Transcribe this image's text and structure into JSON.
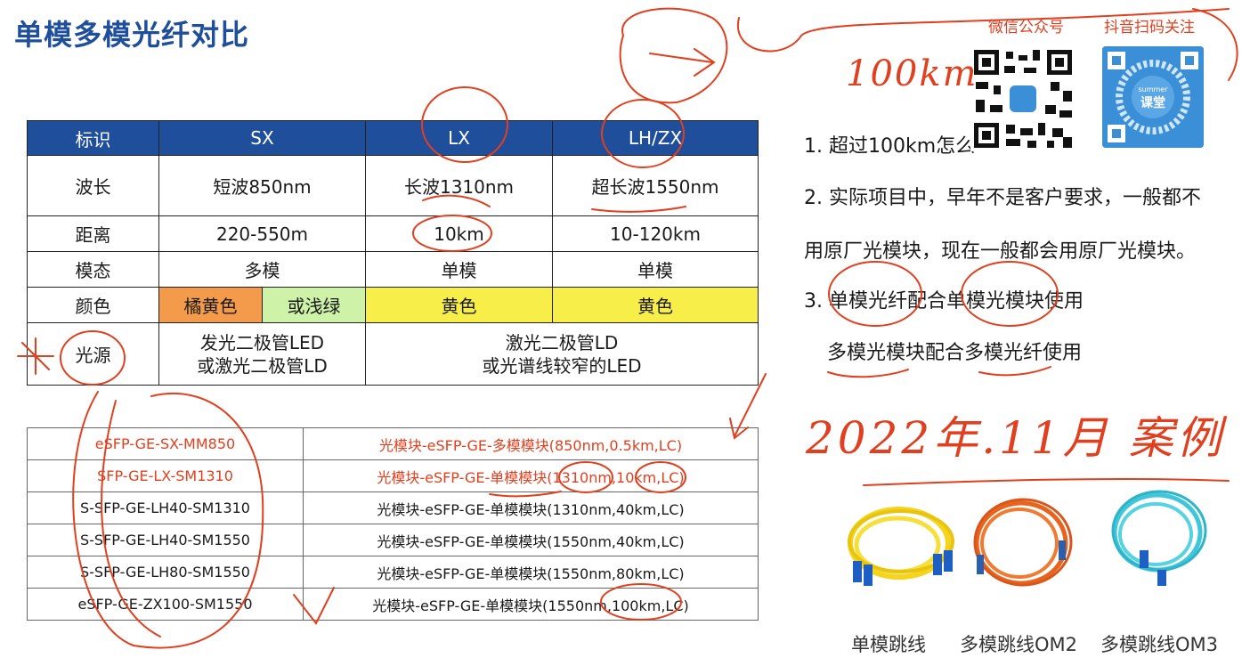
{
  "title": "单模多模光纤对比",
  "table1": {
    "headers": [
      "标识",
      "SX",
      "LX",
      "LH/ZX"
    ],
    "rows": {
      "wavelength": [
        "波长",
        "短波850nm",
        "长波1310nm",
        "超长波1550nm"
      ],
      "distance": [
        "距离",
        "220-550m",
        "10km",
        "10-120km"
      ],
      "mode": [
        "模态",
        "多模",
        "单模",
        "单模"
      ],
      "color": [
        "颜色",
        "橘黄色",
        "或浅绿",
        "黄色",
        "黄色"
      ],
      "source": [
        "光源",
        "发光二极管LED",
        "或激光二极管LD",
        "激光二极管LD",
        "或光谱线较窄的LED"
      ]
    }
  },
  "table2": [
    {
      "code": "eSFP-GE-SX-MM850",
      "desc": "光模块-eSFP-GE-多模模块(850nm,0.5km,LC)",
      "highlight": true
    },
    {
      "code": "SFP-GE-LX-SM1310",
      "desc": "光模块-eSFP-GE-单模模块(1310nm,10km,LC)",
      "highlight": true
    },
    {
      "code": "S-SFP-GE-LH40-SM1310",
      "desc": "光模块-eSFP-GE-单模模块(1310nm,40km,LC)",
      "highlight": false
    },
    {
      "code": "S-SFP-GE-LH40-SM1550",
      "desc": "光模块-eSFP-GE-单模模块(1550nm,40km,LC)",
      "highlight": false
    },
    {
      "code": "S-SFP-GE-LH80-SM1550",
      "desc": "光模块-eSFP-GE-单模模块(1550nm,80km,LC)",
      "highlight": false
    },
    {
      "code": "eSFP-GE-ZX100-SM1550",
      "desc": "光模块-eSFP-GE-单模模块(1550nm,100km,LC)",
      "highlight": false
    }
  ],
  "notes": {
    "line1": "1. 超过100km怎么",
    "line2": "2. 实际项目中，早年不是客户要求，一般都不",
    "line3": "用原厂光模块，现在一般都会用原厂光模块。",
    "line4": "3. 单模光纤配合单模光模块使用",
    "line5": "多模光模块配合多模光纤使用"
  },
  "qr": {
    "label1": "微信公众号",
    "label2": "抖音扫码关注",
    "badge_top": "summer",
    "badge_main": "课堂"
  },
  "handwriting": {
    "km": "100km",
    "date": "2022年.11月 案例"
  },
  "captions": [
    "单模跳线",
    "多模跳线OM2",
    "多模跳线OM3"
  ],
  "colors": {
    "title": "#1f4e9a",
    "header_bg": "#1f4e9a",
    "ink": "#e0401f",
    "orange": "#f39b4a",
    "green": "#cdf2a8",
    "yellow": "#f8ee4a"
  }
}
